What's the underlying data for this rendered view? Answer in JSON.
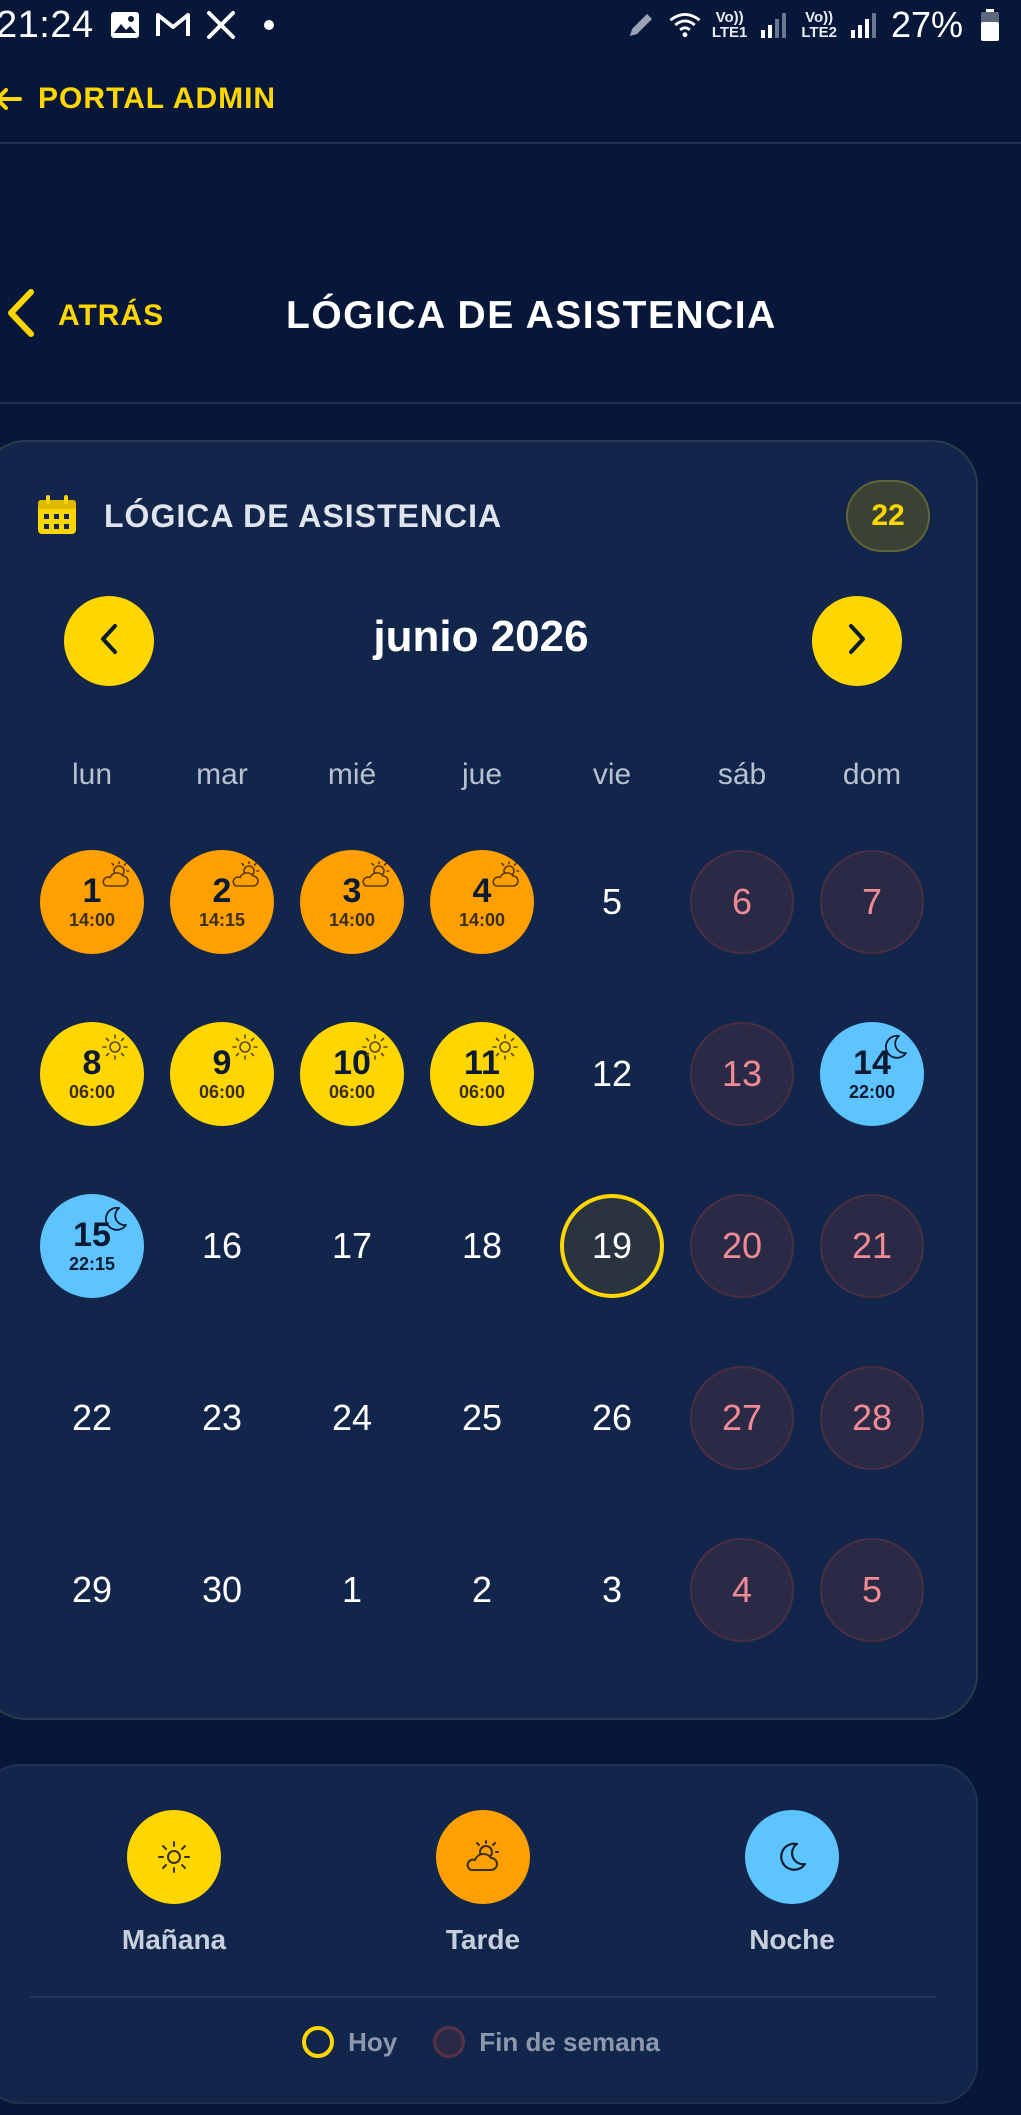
{
  "status_bar": {
    "time": "21:24",
    "lte1": "Vo))\nLTE1",
    "lte2": "Vo))\nLTE2",
    "battery": "27%"
  },
  "app_bar": {
    "title": "PORTAL ADMIN"
  },
  "header": {
    "back_label": "ATRÁS",
    "title": "LÓGICA DE ASISTENCIA"
  },
  "calendar": {
    "title": "LÓGICA DE ASISTENCIA",
    "count": "22",
    "month_label": "junio 2026",
    "weekdays": [
      "lun",
      "mar",
      "mié",
      "jue",
      "vie",
      "sáb",
      "dom"
    ],
    "weeks": [
      [
        {
          "num": "1",
          "type": "afternoon",
          "time": "14:00"
        },
        {
          "num": "2",
          "type": "afternoon",
          "time": "14:15"
        },
        {
          "num": "3",
          "type": "afternoon",
          "time": "14:00"
        },
        {
          "num": "4",
          "type": "afternoon",
          "time": "14:00"
        },
        {
          "num": "5",
          "type": "plain"
        },
        {
          "num": "6",
          "type": "weekend"
        },
        {
          "num": "7",
          "type": "weekend"
        }
      ],
      [
        {
          "num": "8",
          "type": "morning",
          "time": "06:00"
        },
        {
          "num": "9",
          "type": "morning",
          "time": "06:00"
        },
        {
          "num": "10",
          "type": "morning",
          "time": "06:00"
        },
        {
          "num": "11",
          "type": "morning",
          "time": "06:00"
        },
        {
          "num": "12",
          "type": "plain"
        },
        {
          "num": "13",
          "type": "weekend"
        },
        {
          "num": "14",
          "type": "night",
          "time": "22:00"
        }
      ],
      [
        {
          "num": "15",
          "type": "night",
          "time": "22:15"
        },
        {
          "num": "16",
          "type": "plain"
        },
        {
          "num": "17",
          "type": "plain"
        },
        {
          "num": "18",
          "type": "plain"
        },
        {
          "num": "19",
          "type": "today"
        },
        {
          "num": "20",
          "type": "weekend"
        },
        {
          "num": "21",
          "type": "weekend"
        }
      ],
      [
        {
          "num": "22",
          "type": "plain"
        },
        {
          "num": "23",
          "type": "plain"
        },
        {
          "num": "24",
          "type": "plain"
        },
        {
          "num": "25",
          "type": "plain"
        },
        {
          "num": "26",
          "type": "plain"
        },
        {
          "num": "27",
          "type": "weekend"
        },
        {
          "num": "28",
          "type": "weekend"
        }
      ],
      [
        {
          "num": "29",
          "type": "plain"
        },
        {
          "num": "30",
          "type": "plain"
        },
        {
          "num": "1",
          "type": "plain"
        },
        {
          "num": "2",
          "type": "plain"
        },
        {
          "num": "3",
          "type": "plain"
        },
        {
          "num": "4",
          "type": "weekend"
        },
        {
          "num": "5",
          "type": "weekend"
        }
      ]
    ]
  },
  "legend": {
    "morning": "Mañana",
    "afternoon": "Tarde",
    "night": "Noche",
    "today": "Hoy",
    "weekend": "Fin de semana"
  },
  "colors": {
    "background": "#061739",
    "accent": "#ffd600",
    "morning": "#ffd600",
    "afternoon": "#ffa000",
    "night": "#5ec4ff",
    "weekend_text": "#f08a94"
  }
}
